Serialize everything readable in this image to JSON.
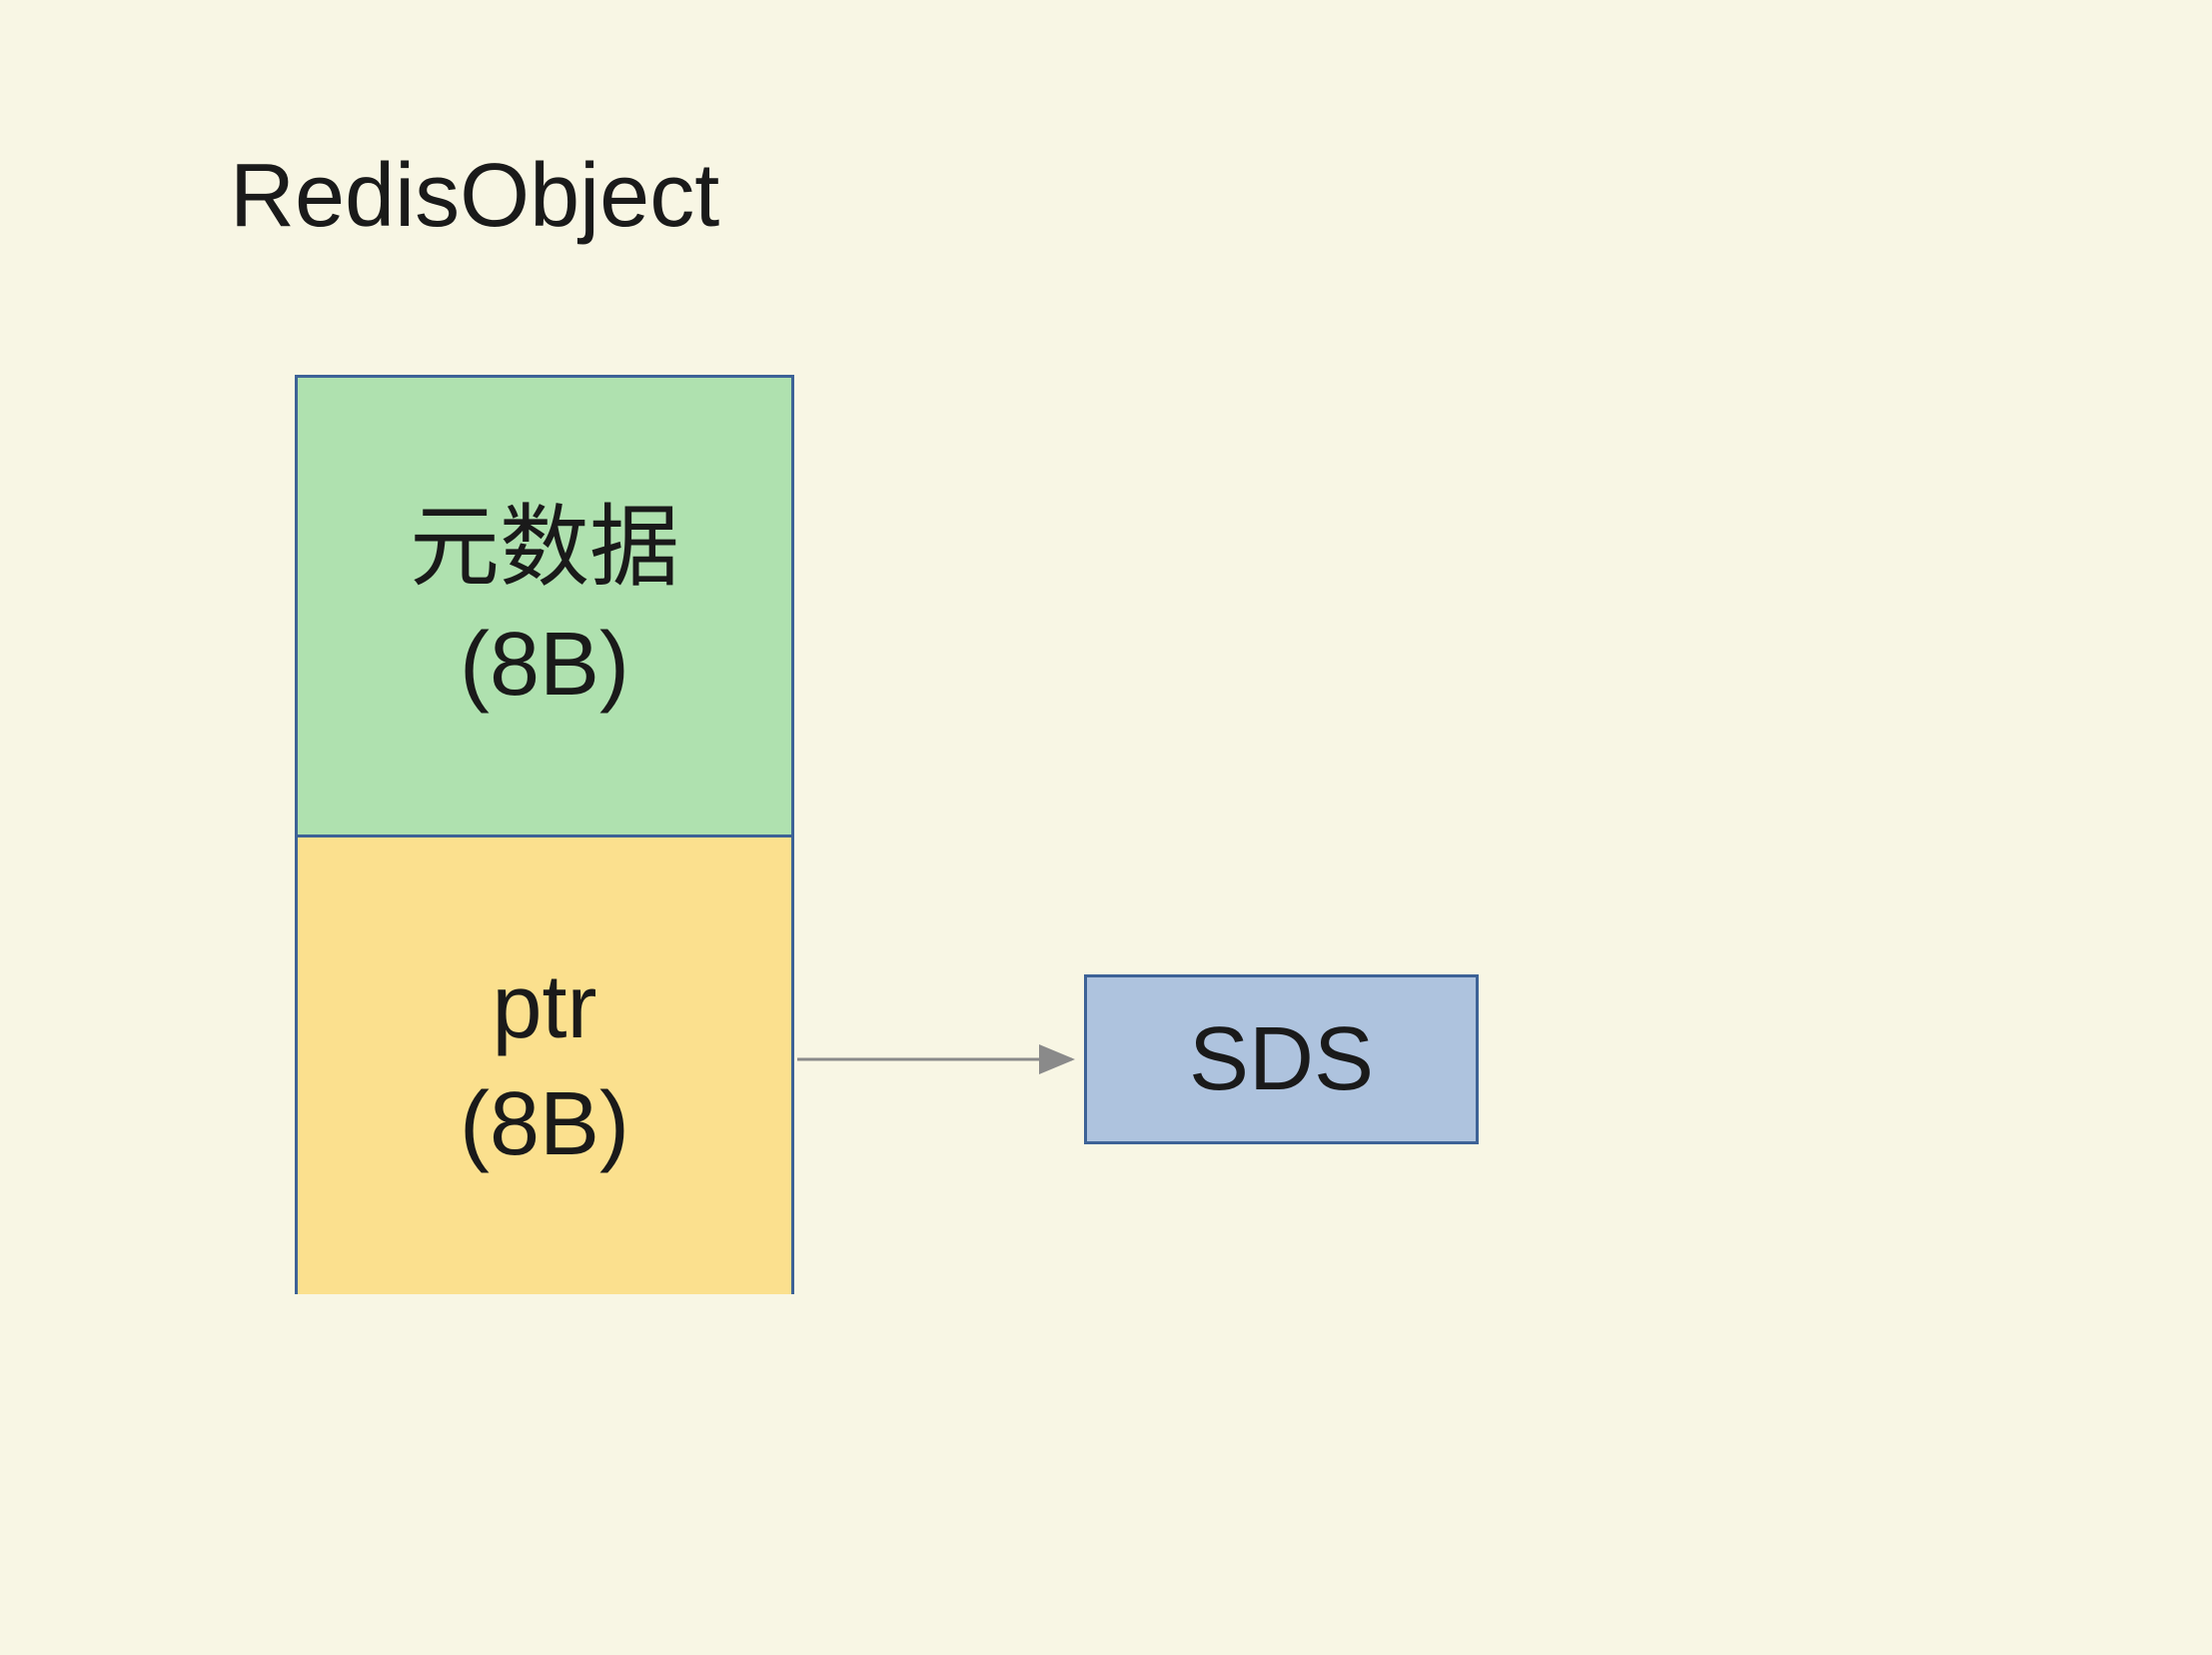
{
  "diagram": {
    "title": "RedisObject",
    "metadata": {
      "label_line1": "元数据",
      "label_line2": "(8B)"
    },
    "ptr": {
      "label_line1": "ptr",
      "label_line2": "(8B)"
    },
    "sds": {
      "label": "SDS"
    }
  },
  "colors": {
    "background": "#f8f6e4",
    "border": "#3d6296",
    "metadata_fill": "#afe1af",
    "ptr_fill": "#fbe08e",
    "sds_fill": "#aec3de",
    "arrow": "#8a8a8a"
  }
}
